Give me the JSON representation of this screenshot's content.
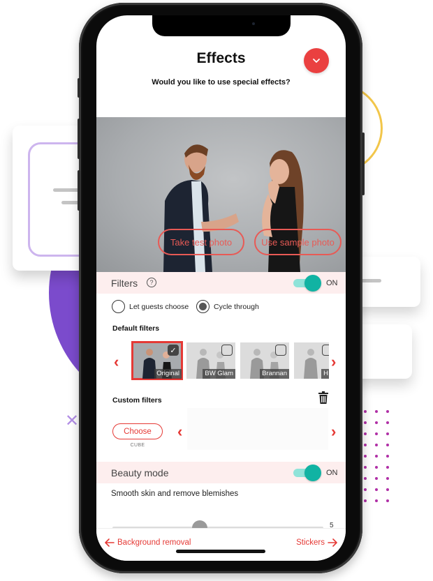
{
  "header": {
    "title": "Effects",
    "subtitle": "Would you like to use special effects?",
    "close_icon": "chevron-down-icon"
  },
  "photo": {
    "take_test_label": "Take test photo",
    "use_sample_label": "Use sample photo"
  },
  "filters": {
    "label": "Filters",
    "help_glyph": "?",
    "toggle_state": "ON",
    "mode_options": [
      {
        "label": "Let guests choose",
        "selected": false
      },
      {
        "label": "Cycle through",
        "selected": true
      }
    ],
    "default_filters_label": "Default filters",
    "default_filters": [
      {
        "name": "Original",
        "checked": true,
        "selected": true
      },
      {
        "name": "BW Glam",
        "checked": false,
        "selected": false
      },
      {
        "name": "Brannan",
        "checked": false,
        "selected": false
      },
      {
        "name": "H",
        "checked": false,
        "selected": false
      }
    ],
    "custom_filters_label": "Custom filters",
    "choose_label": "Choose",
    "choose_caption": "CUBE"
  },
  "beauty": {
    "label": "Beauty mode",
    "toggle_state": "ON",
    "description": "Smooth skin and remove blemishes",
    "slider_value": "5"
  },
  "bottom_nav": {
    "back_label": "Background removal",
    "next_label": "Stickers"
  },
  "colors": {
    "accent_red": "#e53935",
    "toggle_teal": "#11b3a3",
    "band_pink": "#fdeeee",
    "deco_purple": "#7b4bcc",
    "deco_yellow": "#f2c64a"
  }
}
